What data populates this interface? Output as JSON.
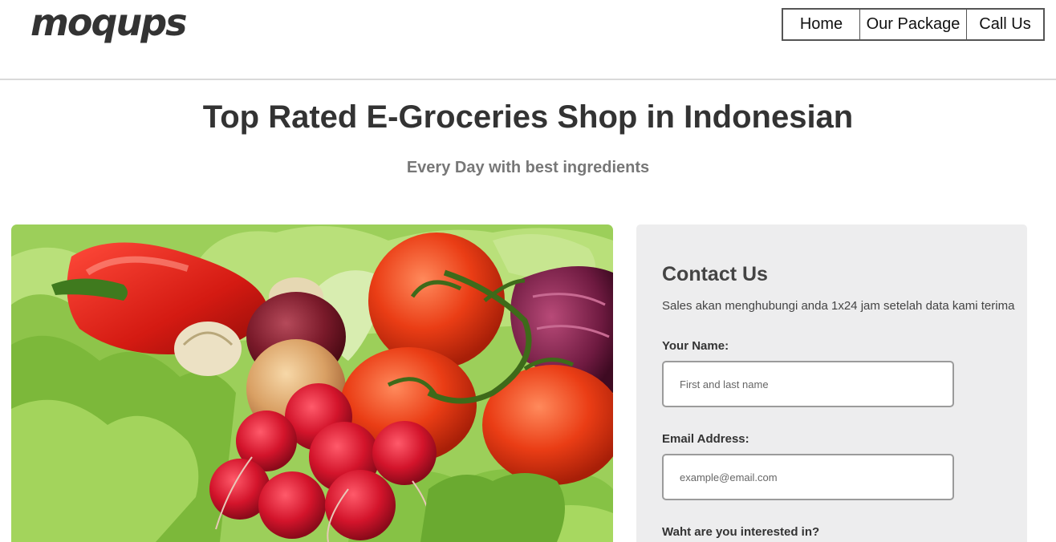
{
  "header": {
    "logo_text": "moqups",
    "nav": {
      "home": "Home",
      "package": "Our Package",
      "call": "Call Us"
    }
  },
  "hero": {
    "title": "Top Rated E-Groceries Shop in Indonesian",
    "subtitle": "Every Day with best ingredients"
  },
  "contact": {
    "title": "Contact Us",
    "note": "Sales akan menghubungi anda 1x24 jam setelah data kami terima",
    "name_label": "Your Name:",
    "name_placeholder": "First and last name",
    "name_value": "",
    "email_label": "Email Address:",
    "email_placeholder": "example@email.com",
    "email_value": "",
    "interest_label": "Waht are you interested in?"
  },
  "colors": {
    "text": "#333333",
    "subtitle": "#777777",
    "panel": "#ededee",
    "field_border": "#9b9b9b"
  }
}
